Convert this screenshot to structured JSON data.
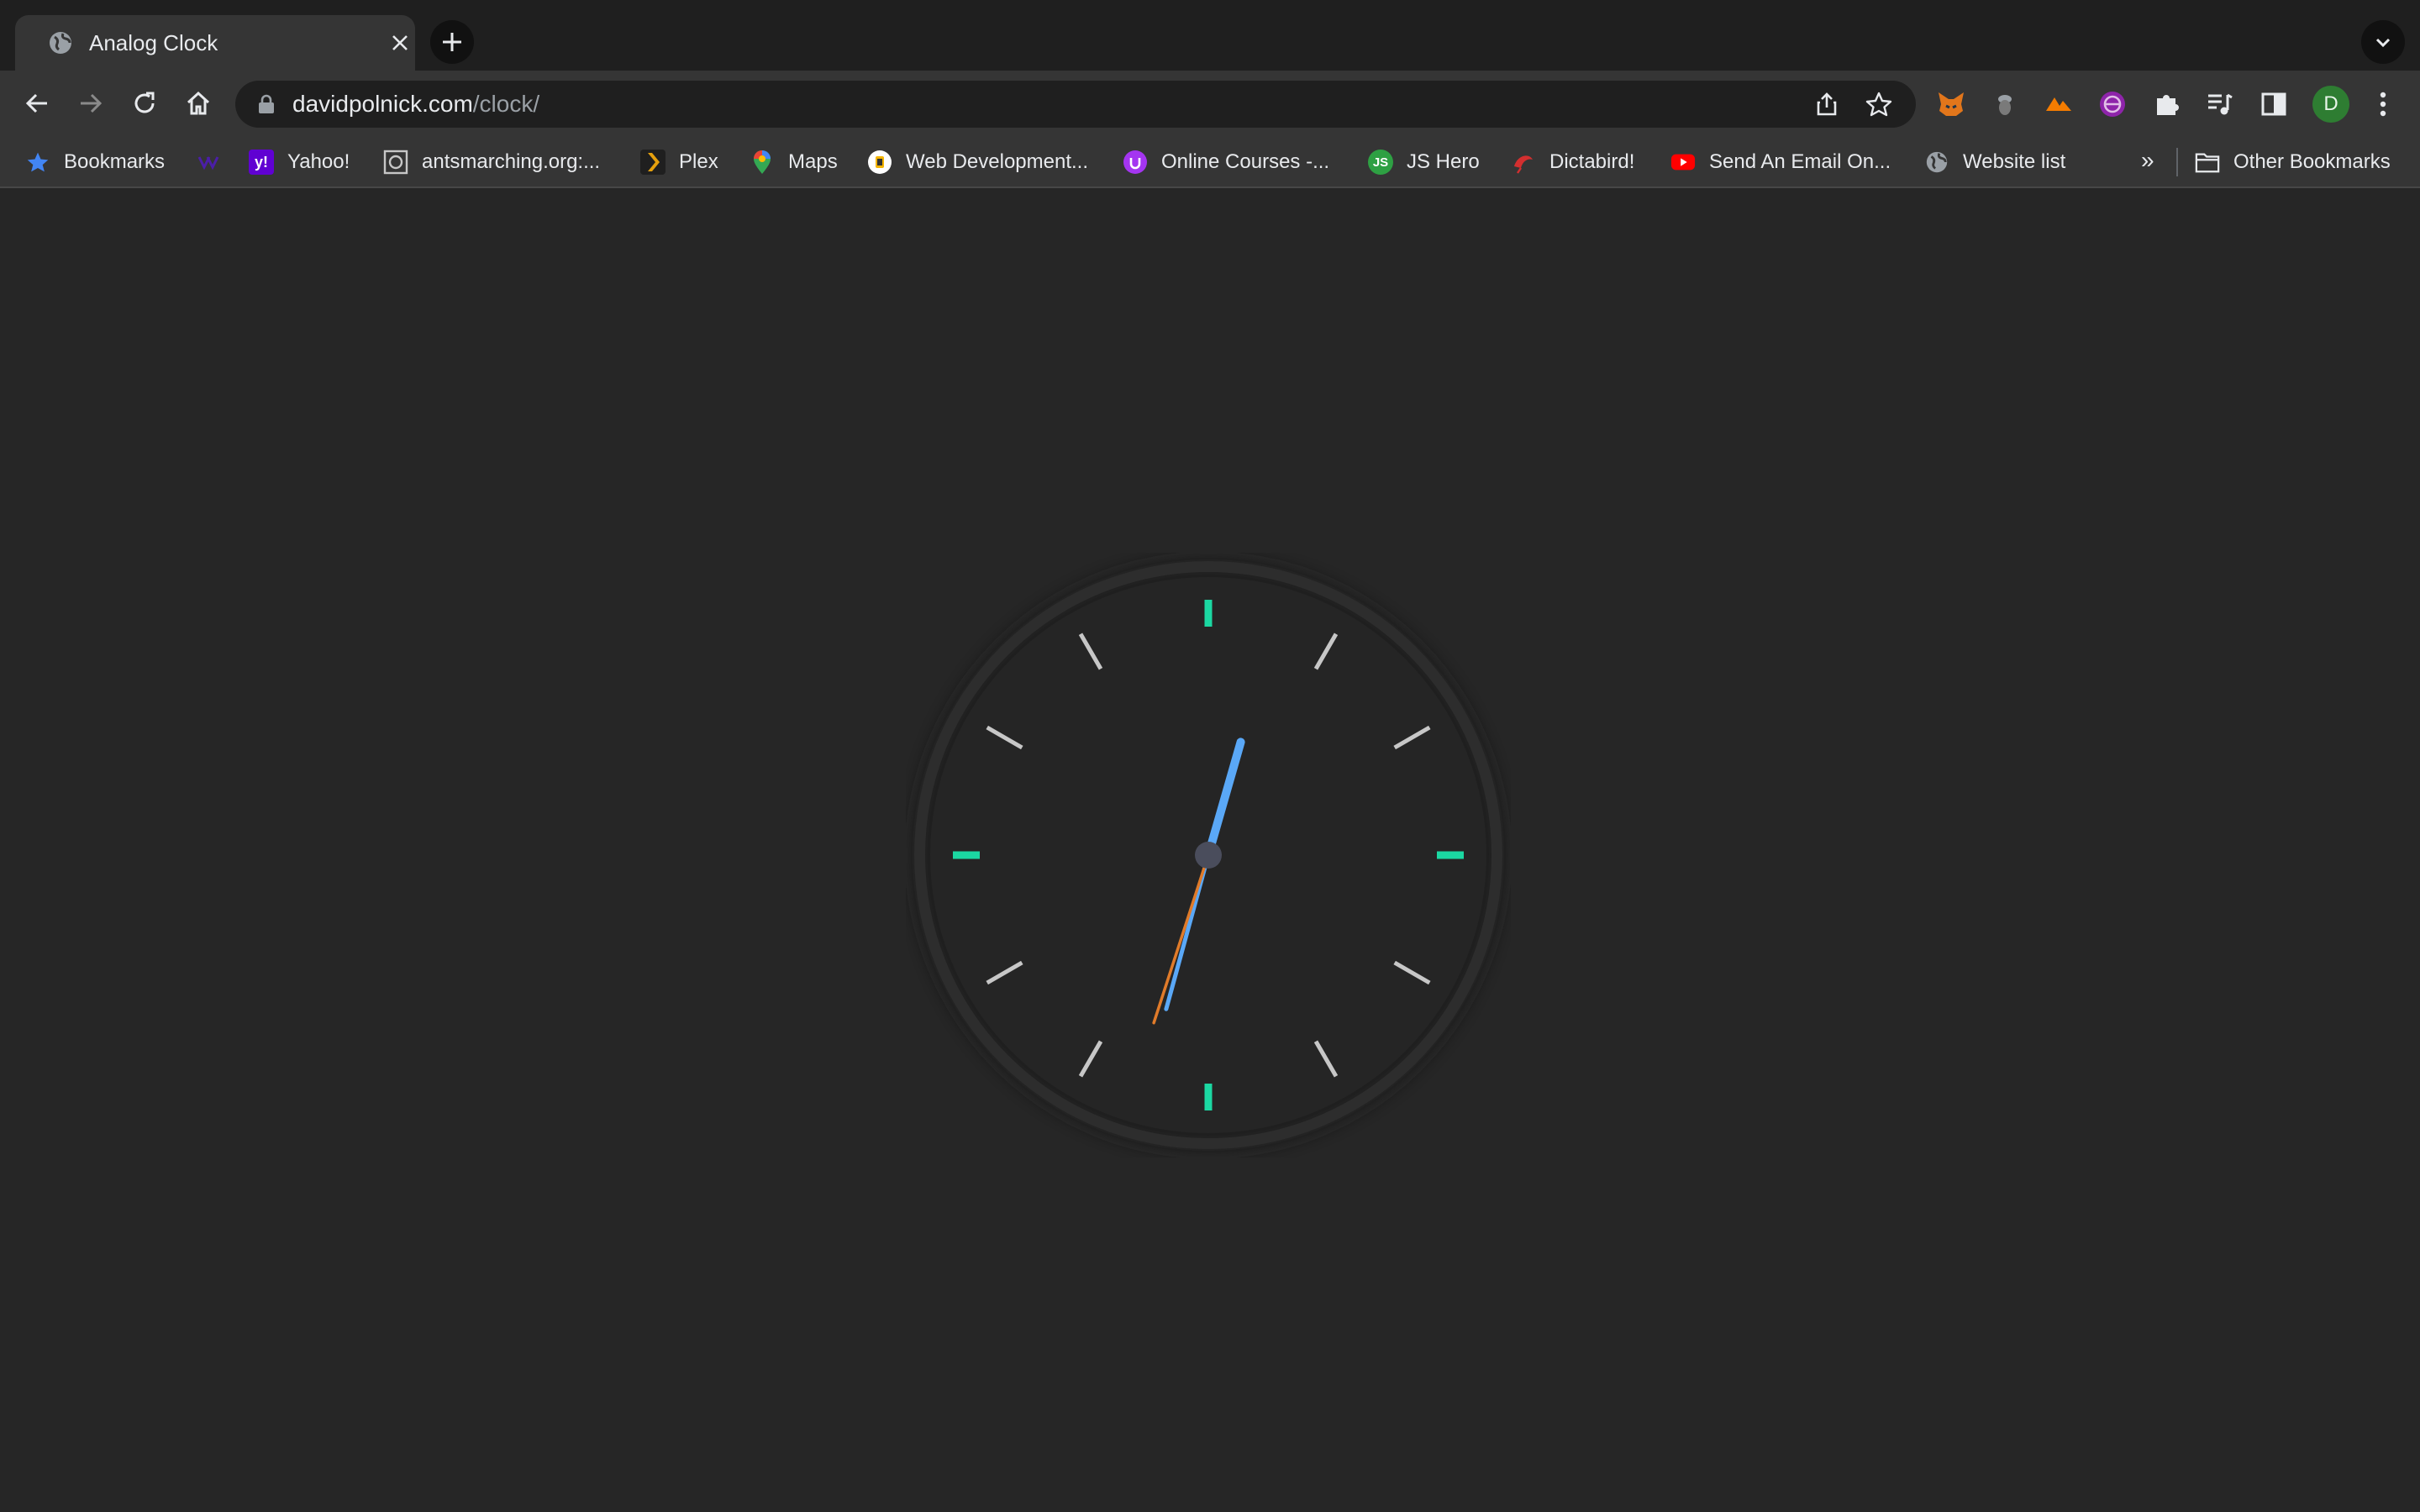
{
  "tab": {
    "title": "Analog Clock"
  },
  "toolbar": {
    "url_host": "davidpolnick.com",
    "url_path": "/clock/",
    "profile_initial": "D"
  },
  "bookmarks": {
    "items": [
      {
        "label": "Bookmarks",
        "icon": "star-icon"
      },
      {
        "label": "",
        "icon": "yahoo-mail-icon"
      },
      {
        "label": "Yahoo!",
        "icon": "yahoo-icon"
      },
      {
        "label": "antsmarching.org:...",
        "icon": "antsmarching-icon"
      },
      {
        "label": "Plex",
        "icon": "plex-icon"
      },
      {
        "label": "Maps",
        "icon": "maps-pin-icon"
      },
      {
        "label": "Web Development...",
        "icon": "webdev-icon"
      },
      {
        "label": "Online Courses -...",
        "icon": "udemy-icon"
      },
      {
        "label": "JS Hero",
        "icon": "jshero-icon"
      },
      {
        "label": "Dictabird!",
        "icon": "dictabird-icon"
      },
      {
        "label": "Send An Email On...",
        "icon": "youtube-icon"
      },
      {
        "label": "Website list",
        "icon": "globe-icon"
      }
    ],
    "overflow": "»",
    "other_label": "Other Bookmarks"
  },
  "clock": {
    "time": {
      "hours": 12,
      "minutes": 32,
      "seconds": 33
    },
    "colors": {
      "hour_marker": "#1bd8a2",
      "minor_marker": "#c7c7c7",
      "hour_hand": "#5aa8f7",
      "minute_hand": "#5aa8f7",
      "second_hand": "#e07b2a",
      "center_cap": "#4a4d5c"
    }
  }
}
